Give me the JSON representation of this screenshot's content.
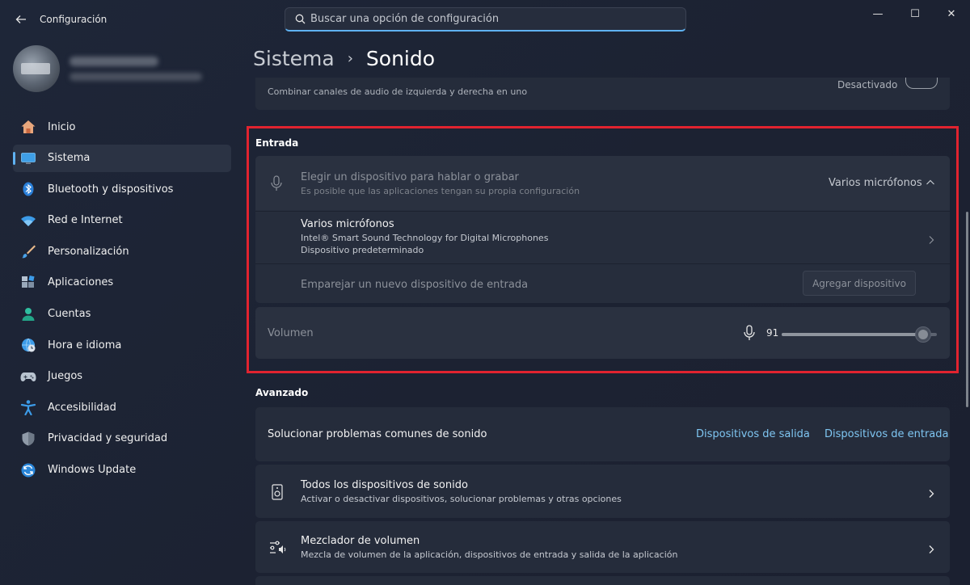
{
  "window": {
    "title": "Configuración",
    "controls": {
      "minimize": "—",
      "maximize": "☐",
      "close": "✕"
    }
  },
  "search": {
    "placeholder": "Buscar una opción de configuración",
    "value": ""
  },
  "breadcrumb": {
    "parent": "Sistema",
    "current": "Sonido"
  },
  "sidebar": {
    "items": [
      {
        "label": "Inicio",
        "icon": "home-icon"
      },
      {
        "label": "Sistema",
        "icon": "monitor-icon",
        "active": true
      },
      {
        "label": "Bluetooth y dispositivos",
        "icon": "bluetooth-icon"
      },
      {
        "label": "Red e Internet",
        "icon": "wifi-icon"
      },
      {
        "label": "Personalización",
        "icon": "brush-icon"
      },
      {
        "label": "Aplicaciones",
        "icon": "apps-icon"
      },
      {
        "label": "Cuentas",
        "icon": "person-icon"
      },
      {
        "label": "Hora e idioma",
        "icon": "globe-clock-icon"
      },
      {
        "label": "Juegos",
        "icon": "gamepad-icon"
      },
      {
        "label": "Accesibilidad",
        "icon": "accessibility-icon"
      },
      {
        "label": "Privacidad y seguridad",
        "icon": "shield-icon"
      },
      {
        "label": "Windows Update",
        "icon": "update-icon"
      }
    ]
  },
  "mono_audio": {
    "description": "Combinar canales de audio de izquierda y derecha en uno",
    "state": "Desactivado"
  },
  "input_section": {
    "title": "Entrada",
    "choose_device": {
      "title": "Elegir un dispositivo para hablar o grabar",
      "subtitle": "Es posible que las aplicaciones tengan su propia configuración",
      "selected": "Varios micrófonos"
    },
    "device": {
      "name": "Varios micrófonos",
      "line1": "Intel® Smart Sound Technology for Digital Microphones",
      "line2": "Dispositivo predeterminado"
    },
    "pair": {
      "label": "Emparejar un nuevo dispositivo de entrada",
      "button": "Agregar dispositivo"
    },
    "volume": {
      "label": "Volumen",
      "value": "91",
      "level": 0.91
    }
  },
  "advanced_section": {
    "title": "Avanzado",
    "troubleshoot": {
      "label": "Solucionar problemas comunes de sonido",
      "link_output": "Dispositivos de salida",
      "link_input": "Dispositivos de entrada"
    },
    "all_devices": {
      "title": "Todos los dispositivos de sonido",
      "subtitle": "Activar o desactivar dispositivos, solucionar problemas y otras opciones"
    },
    "mixer": {
      "title": "Mezclador de volumen",
      "subtitle": "Mezcla de volumen de la aplicación, dispositivos de entrada y salida de la aplicación"
    }
  },
  "colors": {
    "accent": "#5fb2f2",
    "highlight_border": "#e1232f",
    "link": "#7fc6f2"
  }
}
